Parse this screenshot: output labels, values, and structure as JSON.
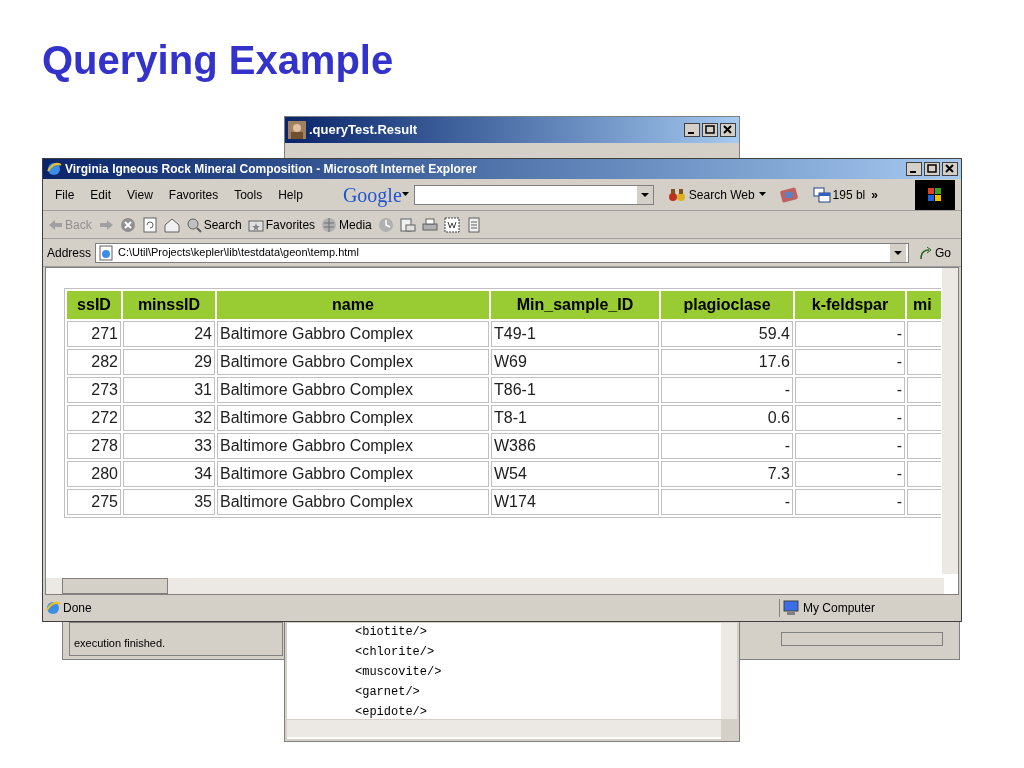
{
  "slide_title": "Querying Example",
  "result_window": {
    "title": ".queryTest.Result",
    "xml_lines": [
      "<biotite/>",
      "<chlorite/>",
      "<muscovite/>",
      "<garnet/>",
      "<epidote/>"
    ]
  },
  "main_window": {
    "status": "execution finished."
  },
  "browser": {
    "title": "Virginia Igneous Rock Mineral Composition - Microsoft Internet Explorer",
    "menu": [
      "File",
      "Edit",
      "View",
      "Favorites",
      "Tools",
      "Help"
    ],
    "google": "Google",
    "search_web": "Search Web",
    "popups": "195 bl",
    "chevron": "»",
    "toolbar": [
      {
        "kind": "back",
        "label": "Back"
      },
      {
        "kind": "forward"
      },
      {
        "kind": "stop"
      },
      {
        "kind": "refresh"
      },
      {
        "kind": "home"
      },
      {
        "kind": "search",
        "label": "Search"
      },
      {
        "kind": "favorites",
        "label": "Favorites"
      },
      {
        "kind": "media",
        "label": "Media"
      },
      {
        "kind": "history"
      },
      {
        "kind": "mail"
      },
      {
        "kind": "print"
      },
      {
        "kind": "edit"
      },
      {
        "kind": "discuss"
      }
    ],
    "address_label": "Address",
    "address": "C:\\Util\\Projects\\kepler\\lib\\testdata\\geon\\temp.html",
    "go": "Go",
    "table": {
      "columns": [
        "ssID",
        "minssID",
        "name",
        "Min_sample_ID",
        "plagioclase",
        "k-feldspar",
        "mi"
      ],
      "rows": [
        [
          "271",
          "24",
          "Baltimore Gabbro Complex",
          "T49-1",
          "59.4",
          "-"
        ],
        [
          "282",
          "29",
          "Baltimore Gabbro Complex",
          "W69",
          "17.6",
          "-"
        ],
        [
          "273",
          "31",
          "Baltimore Gabbro Complex",
          "T86-1",
          "-",
          "-"
        ],
        [
          "272",
          "32",
          "Baltimore Gabbro Complex",
          "T8-1",
          "0.6",
          "-"
        ],
        [
          "278",
          "33",
          "Baltimore Gabbro Complex",
          "W386",
          "-",
          "-"
        ],
        [
          "280",
          "34",
          "Baltimore Gabbro Complex",
          "W54",
          "7.3",
          "-"
        ],
        [
          "275",
          "35",
          "Baltimore Gabbro Complex",
          "W174",
          "-",
          "-"
        ]
      ]
    },
    "status": "Done",
    "zone": "My Computer"
  }
}
